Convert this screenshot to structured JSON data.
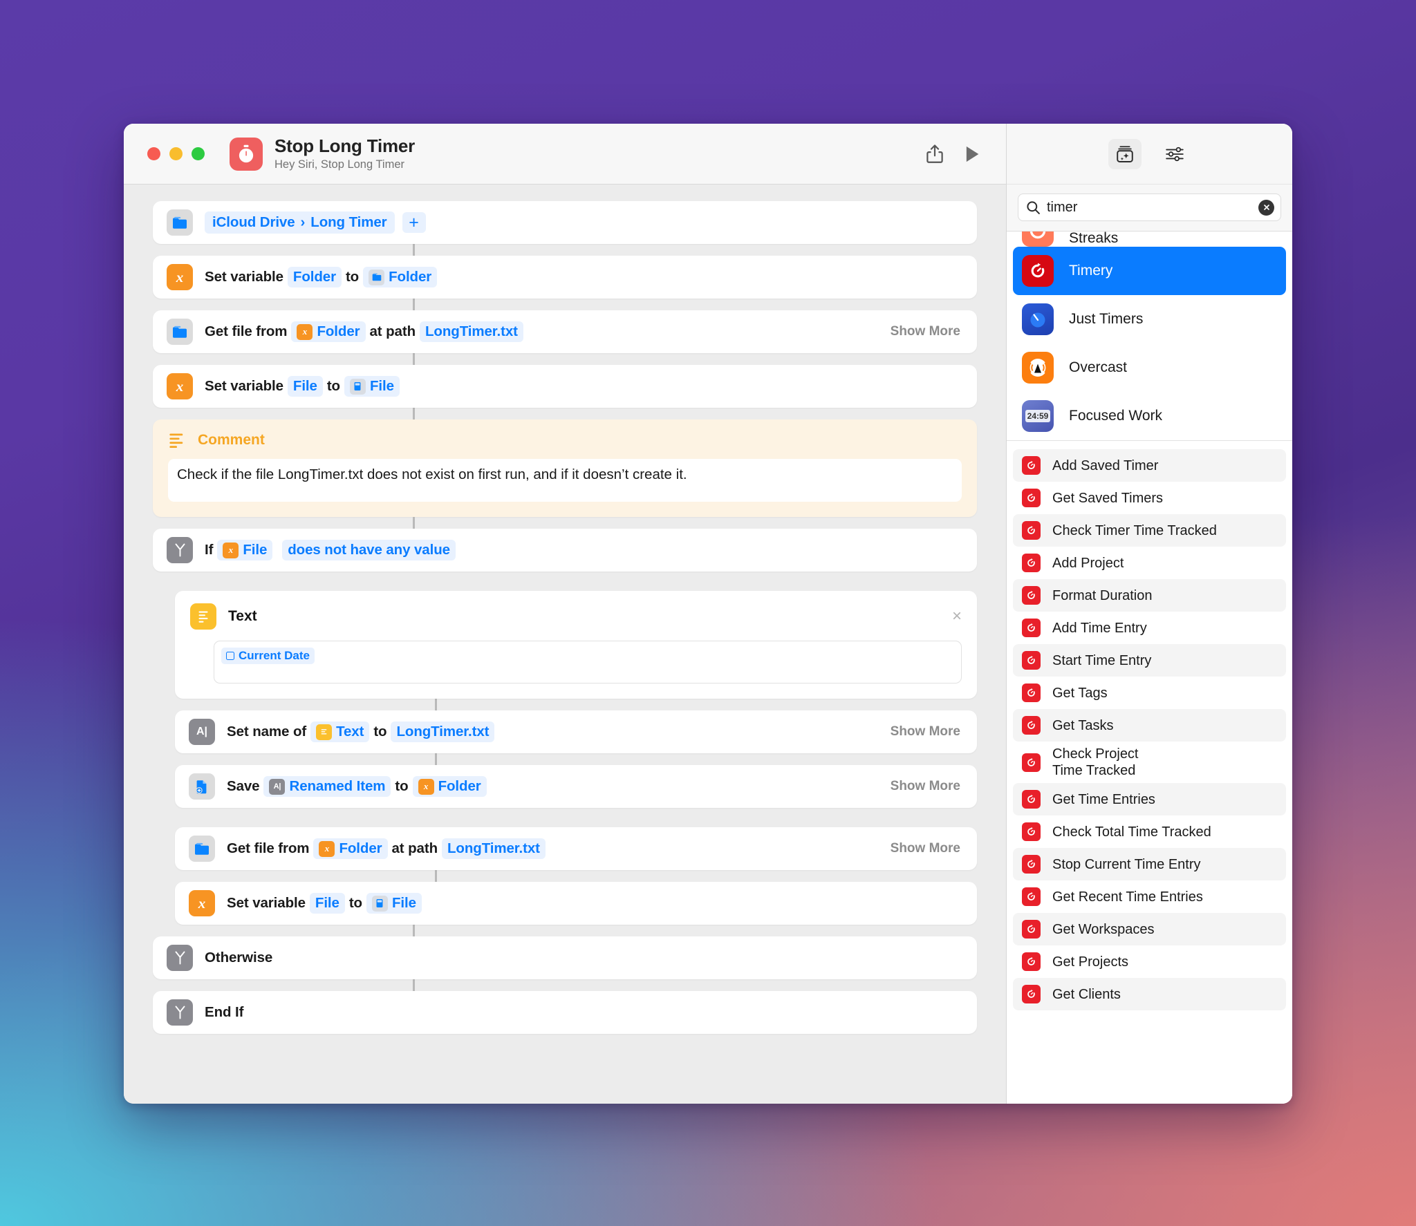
{
  "window": {
    "title": "Stop Long Timer",
    "subtitle": "Hey Siri, Stop Long Timer",
    "app_icon": "stopwatch-icon",
    "accent": "#0a7cff",
    "toolbar": {
      "share_label": "share-icon",
      "run_label": "play-icon"
    }
  },
  "editor": {
    "actions": [
      {
        "id": "folder-picker",
        "icon": "folder-icon",
        "icon_style": "gray-folder",
        "path_prefix": "iCloud Drive",
        "path_sep": "›",
        "path_name": "Long Timer",
        "add_label": "+"
      },
      {
        "id": "set-variable-folder",
        "icon": "variable-icon",
        "icon_style": "orange",
        "icon_glyph": "x",
        "prefix": "Set variable",
        "var_name": "Folder",
        "middle": "to",
        "value_badge": "folder-icon",
        "value_name": "Folder"
      },
      {
        "id": "get-file-1",
        "icon": "folder-icon",
        "icon_style": "gray-folder",
        "prefix": "Get file from",
        "source_badge": "variable-icon",
        "source_name": "Folder",
        "middle": "at path",
        "path_value": "LongTimer.txt",
        "show_more": "Show More"
      },
      {
        "id": "set-variable-file-1",
        "icon": "variable-icon",
        "icon_style": "orange",
        "icon_glyph": "x",
        "prefix": "Set variable",
        "var_name": "File",
        "middle": "to",
        "value_badge": "file-icon",
        "value_name": "File"
      }
    ],
    "comment": {
      "icon": "comment-lines-icon",
      "label": "Comment",
      "body": "Check if the file LongTimer.txt does not exist on first run, and if it doesn’t create it."
    },
    "if_block": {
      "icon": "branch-icon",
      "keyword": "If",
      "subject_badge": "variable-icon",
      "subject": "File",
      "condition": "does not have any value"
    },
    "text_action": {
      "icon": "text-icon",
      "title": "Text",
      "close_label": "×",
      "token_icon": "calendar-icon",
      "token_label": "Current Date"
    },
    "inner_actions": [
      {
        "id": "set-name",
        "icon": "rename-icon",
        "icon_style": "gray",
        "icon_glyph": "A|",
        "prefix": "Set name of",
        "source_badge": "text-icon",
        "source_name": "Text",
        "middle": "to",
        "path_value": "LongTimer.txt",
        "show_more": "Show More"
      },
      {
        "id": "save-file",
        "icon": "save-file-icon",
        "icon_style": "gray-doc",
        "prefix": "Save",
        "source_badge": "rename-icon",
        "source_name": "Renamed Item",
        "middle": "to",
        "target_badge": "variable-icon",
        "target_name": "Folder",
        "show_more": "Show More"
      },
      {
        "id": "get-file-2",
        "icon": "folder-icon",
        "icon_style": "gray-folder",
        "prefix": "Get file from",
        "source_badge": "variable-icon",
        "source_name": "Folder",
        "middle": "at path",
        "path_value": "LongTimer.txt",
        "show_more": "Show More"
      },
      {
        "id": "set-variable-file-2",
        "icon": "variable-icon",
        "icon_style": "orange",
        "icon_glyph": "x",
        "prefix": "Set variable",
        "var_name": "File",
        "middle": "to",
        "value_badge": "file-icon",
        "value_name": "File"
      }
    ],
    "otherwise": {
      "icon": "branch-icon",
      "label": "Otherwise"
    },
    "end_if": {
      "icon": "branch-icon",
      "label": "End If"
    }
  },
  "library": {
    "toolbar": {
      "action_library_icon": "action-library-icon",
      "settings_icon": "sliders-icon"
    },
    "search": {
      "icon": "search-icon",
      "value": "timer",
      "placeholder": "Search",
      "clear_icon": "close-circle-icon"
    },
    "apps": [
      {
        "name": "Streaks",
        "icon": "streaks-app-icon",
        "partial": true,
        "selected": false
      },
      {
        "name": "Timery",
        "icon": "timery-app-icon",
        "partial": false,
        "selected": true
      },
      {
        "name": "Just Timers",
        "icon": "just-timers-app-icon",
        "partial": false,
        "selected": false
      },
      {
        "name": "Overcast",
        "icon": "overcast-app-icon",
        "partial": false,
        "selected": false
      },
      {
        "name": "Focused Work",
        "icon": "focused-work-app-icon",
        "badge_text": "24:59",
        "partial": false,
        "selected": false
      }
    ],
    "actions": [
      {
        "name": "Add Saved Timer",
        "icon": "timery-action-icon"
      },
      {
        "name": "Get Saved Timers",
        "icon": "timery-action-icon"
      },
      {
        "name": "Check Timer Time Tracked",
        "icon": "timery-action-icon"
      },
      {
        "name": "Add Project",
        "icon": "timery-action-icon"
      },
      {
        "name": "Format Duration",
        "icon": "timery-action-icon"
      },
      {
        "name": "Add Time Entry",
        "icon": "timery-action-icon"
      },
      {
        "name": "Start Time Entry",
        "icon": "timery-action-icon"
      },
      {
        "name": "Get Tags",
        "icon": "timery-action-icon"
      },
      {
        "name": "Get Tasks",
        "icon": "timery-action-icon"
      },
      {
        "name": "Check Project\nTime Tracked",
        "icon": "timery-action-icon"
      },
      {
        "name": "Get Time Entries",
        "icon": "timery-action-icon"
      },
      {
        "name": "Check Total Time Tracked",
        "icon": "timery-action-icon"
      },
      {
        "name": "Stop Current Time Entry",
        "icon": "timery-action-icon"
      },
      {
        "name": "Get Recent Time Entries",
        "icon": "timery-action-icon"
      },
      {
        "name": "Get Workspaces",
        "icon": "timery-action-icon"
      },
      {
        "name": "Get Projects",
        "icon": "timery-action-icon"
      },
      {
        "name": "Get Clients",
        "icon": "timery-action-icon"
      }
    ]
  }
}
